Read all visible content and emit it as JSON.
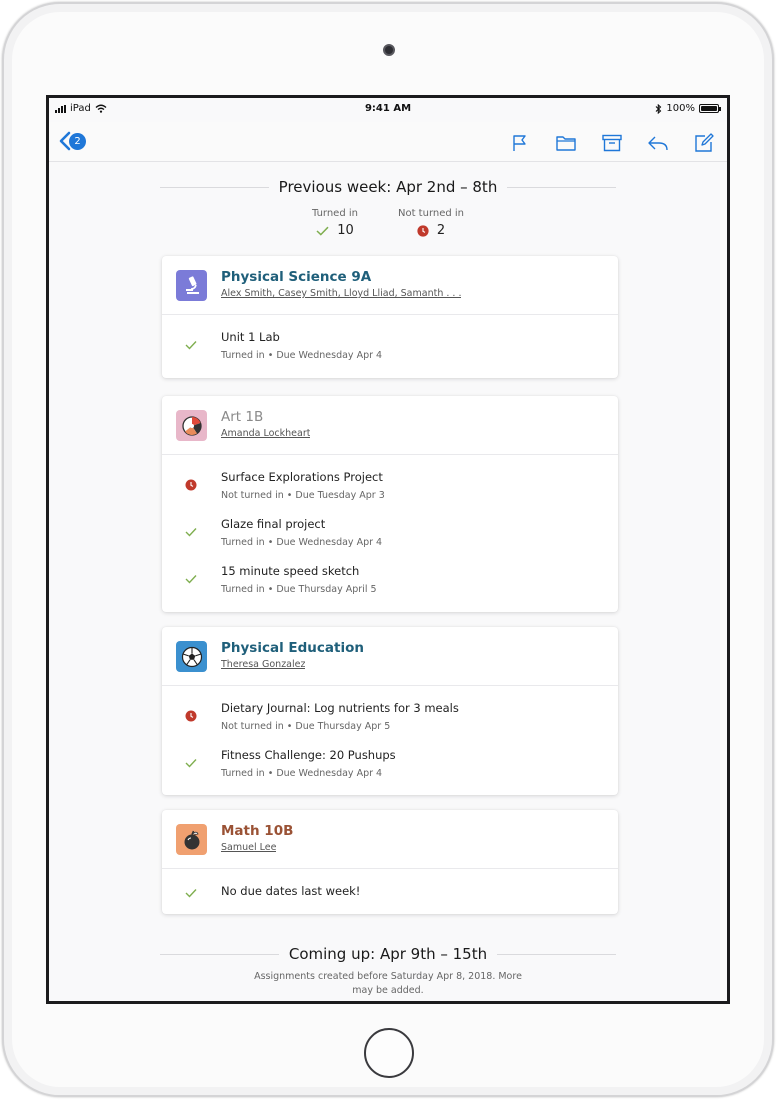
{
  "status_bar": {
    "carrier": "iPad",
    "time": "9:41 AM",
    "battery": "100%",
    "battery_level": 1.0
  },
  "toolbar": {
    "back_badge": "2",
    "actions": [
      "flag-icon",
      "folder-icon",
      "archive-icon",
      "reply-icon",
      "compose-icon"
    ]
  },
  "previous_week": {
    "title": "Previous week: Apr 2nd – 8th",
    "turned_in_label": "Turned in",
    "turned_in_count": "10",
    "not_turned_in_label": "Not turned in",
    "not_turned_in_count": "2"
  },
  "classes": [
    {
      "name": "Physical Science 9A",
      "color": "#1f5f7a",
      "icon": "microscope-icon",
      "teachers": "Alex Smith, Casey Smith, Lloyd Lliad, Samanth . . .",
      "assignments": [
        {
          "title": "Unit 1 Lab",
          "status": "Turned in",
          "due": " • Due Wednesday Apr 4",
          "state": "done"
        }
      ]
    },
    {
      "name": "Art 1B",
      "color": "#8a8a8a",
      "icon": "palette-icon",
      "teachers": "Amanda Lockheart",
      "assignments": [
        {
          "title": "Surface Explorations Project",
          "status": "Not turned in",
          "due": " • Due Tuesday Apr 3",
          "state": "late"
        },
        {
          "title": "Glaze final project",
          "status": "Turned in",
          "due": " • Due Wednesday Apr 4",
          "state": "done"
        },
        {
          "title": "15 minute speed sketch",
          "status": "Turned in",
          "due": " • Due Thursday April 5",
          "state": "done"
        }
      ]
    },
    {
      "name": "Physical Education",
      "color": "#1f5f7a",
      "icon": "soccer-ball-icon",
      "teachers": "Theresa Gonzalez",
      "assignments": [
        {
          "title": "Dietary Journal: Log nutrients for 3 meals",
          "status": "Not turned in",
          "due": " • Due Thursday Apr 5",
          "state": "late"
        },
        {
          "title": "Fitness Challenge: 20 Pushups",
          "status": "Turned in",
          "due": " • Due Wednesday Apr 4",
          "state": "done"
        }
      ]
    },
    {
      "name": "Math 10B",
      "color": "#9a5235",
      "icon": "apple-icon",
      "teachers": "Samuel Lee",
      "assignments": [
        {
          "title": "No due dates last week!",
          "status": "",
          "due": "",
          "state": "done"
        }
      ]
    }
  ],
  "coming_up": {
    "title": "Coming up: Apr 9th – 15th",
    "note_line1": "Assignments created before Saturday Apr 8, 2018. More",
    "note_line2": "may be added."
  },
  "colors": {
    "accent": "#1f77d8",
    "check": "#7fae4f",
    "late": "#c0392b",
    "science_icon_bg": "#7b7bd8",
    "art_icon_bg": "#e8b7c9",
    "pe_icon_bg": "#3b90cf",
    "math_icon_bg": "#f0a070"
  }
}
